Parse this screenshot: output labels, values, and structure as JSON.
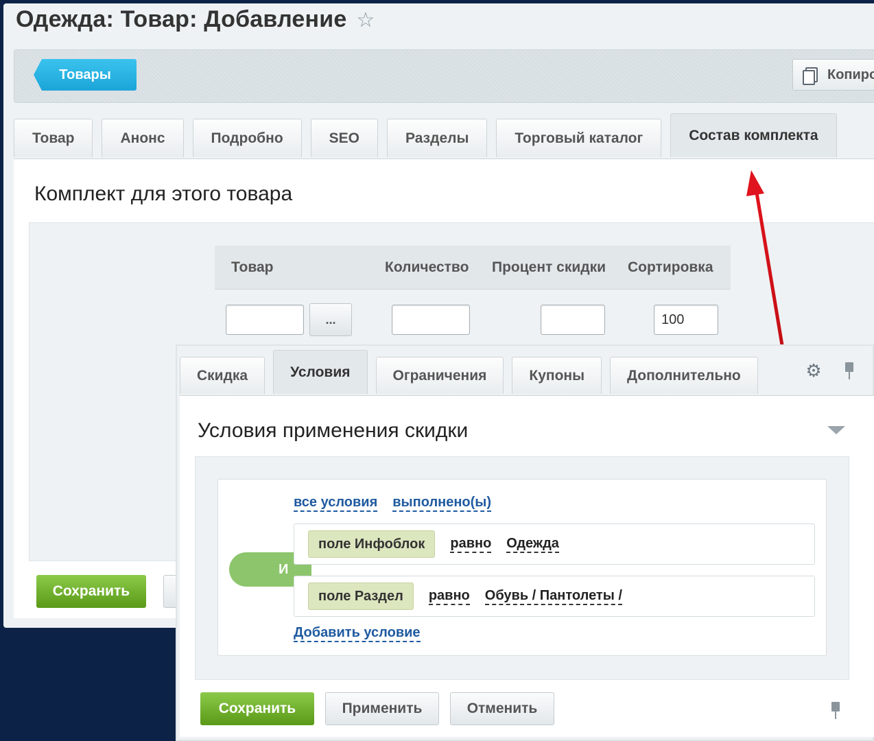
{
  "page": {
    "title": "Одежда: Товар: Добавление",
    "star_icon": "star-icon"
  },
  "toolbar": {
    "back_label": "Товары",
    "copy_label": "Копиро"
  },
  "tabs_main": [
    "Товар",
    "Анонс",
    "Подробно",
    "SEO",
    "Разделы",
    "Торговый каталог",
    "Состав комплекта"
  ],
  "kit": {
    "title": "Комплект для этого товара",
    "columns": [
      "Товар",
      "Количество",
      "Процент скидки",
      "Сортировка"
    ],
    "row": {
      "product": "",
      "dots": "...",
      "quantity": "",
      "discount": "",
      "sort": "100"
    }
  },
  "back_buttons": {
    "save": "Сохранить"
  },
  "tabs_discount": [
    "Скидка",
    "Условия",
    "Ограничения",
    "Купоны",
    "Дополнительно"
  ],
  "conditions": {
    "title": "Условия применения скидки",
    "all_conditions": "все условия",
    "fulfilled": "выполнено(ы)",
    "logic": "И",
    "rows": [
      {
        "field": "поле Инфоблок",
        "op": "равно",
        "value": "Одежда"
      },
      {
        "field": "поле Раздел",
        "op": "равно",
        "value": "Обувь / Пантолеты /"
      }
    ],
    "add": "Добавить условие"
  },
  "front_buttons": {
    "save": "Сохранить",
    "apply": "Применить",
    "cancel": "Отменить"
  },
  "colors": {
    "accent_blue": "#1ba4d8",
    "save_green": "#5a9a18",
    "annotation_red": "#e0141e",
    "background": "#0c2347"
  }
}
